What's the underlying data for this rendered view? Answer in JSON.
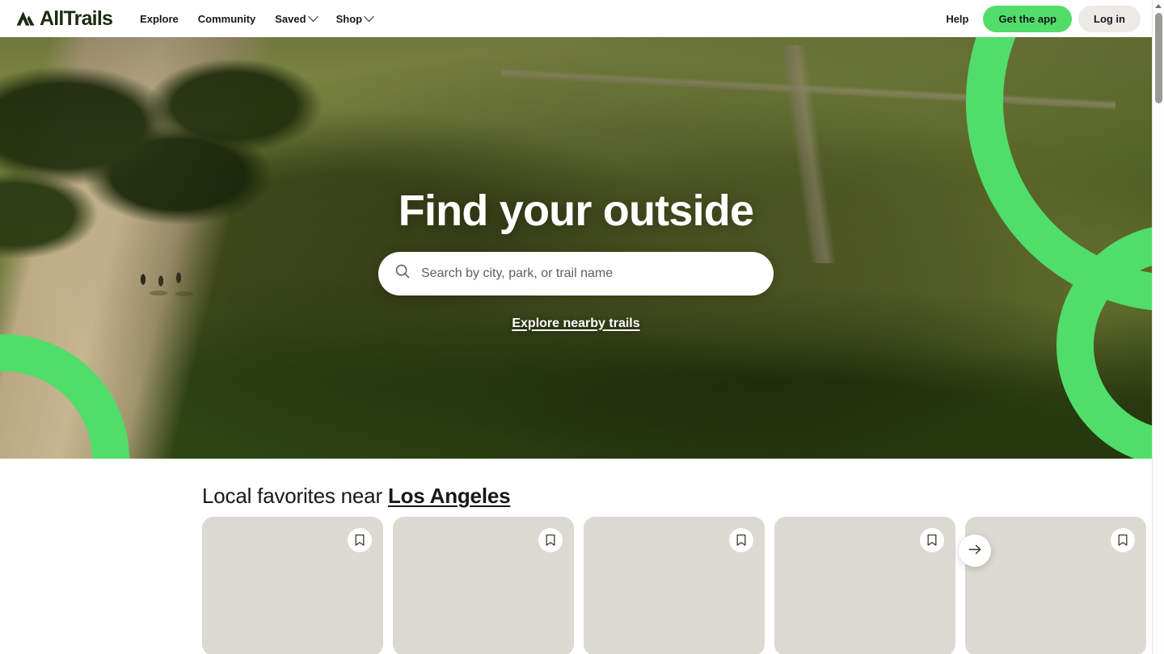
{
  "header": {
    "logo_text": "AllTrails",
    "logo_icon": "mountain-icon",
    "nav_items": [
      {
        "label": "Explore",
        "has_chevron": false
      },
      {
        "label": "Community",
        "has_chevron": false
      },
      {
        "label": "Saved",
        "has_chevron": true
      },
      {
        "label": "Shop",
        "has_chevron": true
      }
    ],
    "help_label": "Help",
    "get_app_label": "Get the app",
    "login_label": "Log in"
  },
  "hero": {
    "title": "Find your outside",
    "search": {
      "placeholder": "Search by city, park, or trail name",
      "value": "",
      "icon": "search-icon"
    },
    "nearby_link_label": "Explore nearby trails"
  },
  "favorites": {
    "heading_prefix": "Local favorites near ",
    "city": "Los Angeles",
    "cards": [
      {
        "bookmark_icon": "bookmark-icon"
      },
      {
        "bookmark_icon": "bookmark-icon"
      },
      {
        "bookmark_icon": "bookmark-icon"
      },
      {
        "bookmark_icon": "bookmark-icon"
      },
      {
        "bookmark_icon": "bookmark-icon"
      }
    ],
    "next_icon": "arrow-right-icon"
  },
  "colors": {
    "brand_green": "#51dd69",
    "logo_dark": "#1b2b10",
    "text": "#16181c",
    "login_bg": "#eceae5",
    "card_placeholder": "#dbdad1"
  }
}
